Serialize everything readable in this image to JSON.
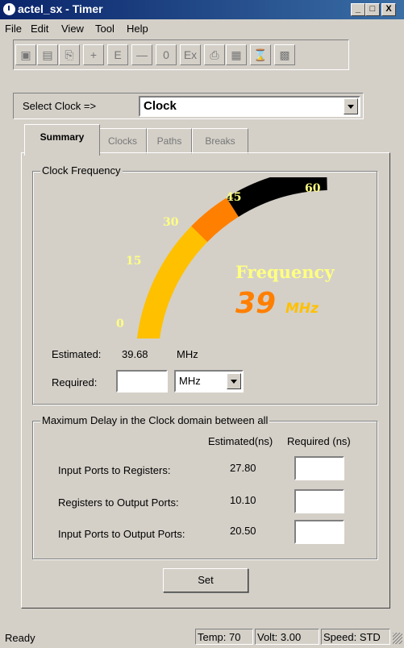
{
  "window": {
    "title": "actel_sx - Timer",
    "controls": [
      "_",
      "□",
      "X"
    ]
  },
  "menu": [
    "File",
    "Edit",
    "View",
    "Tool",
    "Help"
  ],
  "toolbar": {
    "buttons": [
      "▣",
      "▤",
      "⎘",
      "+",
      "E",
      "—",
      "0",
      "Ex",
      "⎙",
      "▦",
      "⌛",
      "▩"
    ]
  },
  "select_clock": {
    "label": "Select Clock =>",
    "value": "Clock"
  },
  "tabs": [
    "Summary",
    "Clocks",
    "Paths",
    "Breaks"
  ],
  "active_tab": "Summary",
  "clock_frequency": {
    "legend": "Clock Frequency",
    "gauge": {
      "ticks": [
        "0",
        "15",
        "30",
        "45",
        "60"
      ],
      "label": "Frequency",
      "value": "39",
      "unit": "MHz",
      "min": 0,
      "max": 60,
      "fill_level": 39,
      "colors": {
        "low": "#ffc000",
        "mid": "#ff7f00",
        "high": "#000000",
        "label": "#ffff80",
        "value": "#ff7f00"
      }
    },
    "estimated_label": "Estimated:",
    "estimated_value": "39.68",
    "estimated_unit": "MHz",
    "required_label": "Required:",
    "required_value": "",
    "required_unit": "MHz"
  },
  "max_delay": {
    "legend": "Maximum Delay in the Clock domain between all",
    "col_estimated": "Estimated(ns)",
    "col_required": "Required (ns)",
    "rows": [
      {
        "label": "Input Ports to Registers:",
        "estimated": "27.80",
        "required": ""
      },
      {
        "label": "Registers to Output Ports:",
        "estimated": "10.10",
        "required": ""
      },
      {
        "label": "Input Ports to Output Ports:",
        "estimated": "20.50",
        "required": ""
      }
    ]
  },
  "set_button": "Set",
  "status": {
    "text": "Ready",
    "temp": "Temp: 70",
    "volt": "Volt: 3.00",
    "speed": "Speed: STD"
  }
}
